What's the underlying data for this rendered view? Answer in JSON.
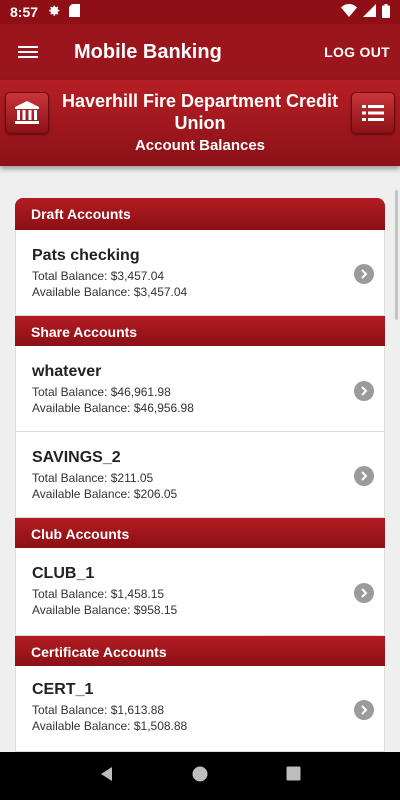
{
  "status": {
    "time": "8:57"
  },
  "appbar": {
    "title": "Mobile Banking",
    "logout_label": "LOG OUT"
  },
  "header": {
    "institution": "Haverhill Fire Department Credit Union",
    "subtitle": "Account Balances"
  },
  "sections": [
    {
      "title": "Draft Accounts",
      "accounts": [
        {
          "name": "Pats checking",
          "total": "Total Balance: $3,457.04",
          "available": "Available Balance: $3,457.04"
        }
      ]
    },
    {
      "title": "Share Accounts",
      "accounts": [
        {
          "name": "whatever",
          "total": "Total Balance: $46,961.98",
          "available": "Available Balance: $46,956.98"
        },
        {
          "name": "SAVINGS_2",
          "total": "Total Balance: $211.05",
          "available": "Available Balance: $206.05"
        }
      ]
    },
    {
      "title": "Club Accounts",
      "accounts": [
        {
          "name": "CLUB_1",
          "total": "Total Balance: $1,458.15",
          "available": "Available Balance: $958.15"
        }
      ]
    },
    {
      "title": "Certificate Accounts",
      "accounts": [
        {
          "name": "CERT_1",
          "total": "Total Balance: $1,613.88",
          "available": "Available Balance: $1,508.88"
        }
      ]
    }
  ],
  "colors": {
    "brand": "#9a161c",
    "status_bar": "#8e1016"
  }
}
